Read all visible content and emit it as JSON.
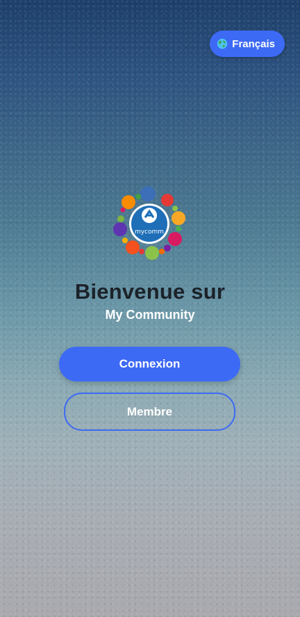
{
  "language_button": {
    "label": "Français",
    "icon": "globe-icon"
  },
  "logo": {
    "text": "mycomm",
    "icon": "community-logo"
  },
  "welcome": {
    "title": "Bienvenue sur",
    "subtitle": "My Community"
  },
  "actions": {
    "login_label": "Connexion",
    "member_label": "Membre"
  },
  "colors": {
    "accent": "#3d6af5",
    "title_text": "#1c2229",
    "light_text": "#ffffff"
  }
}
